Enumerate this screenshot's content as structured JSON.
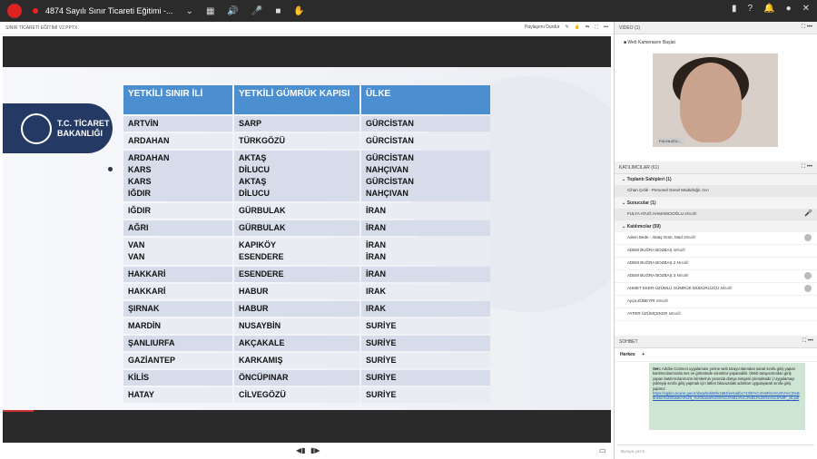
{
  "topbar": {
    "title": "4874 Sayılı Sınır Ticareti Eğitimi -..."
  },
  "share_pod": {
    "title": "SINIR TİCARETİ EĞİTİMİ V2.PPTX",
    "stop_sharing": "Paylaşımı Durdur"
  },
  "slide": {
    "ministry": [
      "T.C. TİCARET",
      "BAKANLIĞI"
    ],
    "headers": [
      "YETKİLİ SINIR İLİ",
      "YETKİLİ GÜMRÜK KAPISI",
      "ÜLKE"
    ],
    "rows": [
      {
        "a": "ARTVİN",
        "b": "SARP",
        "c": "GÜRCİSTAN"
      },
      {
        "a": "ARDAHAN",
        "b": "TÜRKGÖZÜ",
        "c": "GÜRCİSTAN"
      },
      {
        "a": "ARDAHAN\nKARS\nKARS\nIĞDIR",
        "b": "AKTAŞ\nDİLUCU\nAKTAŞ\nDİLUCU",
        "c": "GÜRCİSTAN\nNAHÇIVAN\nGÜRCİSTAN\nNAHÇIVAN"
      },
      {
        "a": "IĞDIR",
        "b": "GÜRBULAK",
        "c": "İRAN"
      },
      {
        "a": "AĞRI",
        "b": "GÜRBULAK",
        "c": "İRAN"
      },
      {
        "a": "VAN\nVAN",
        "b": "KAPIKÖY\nESENDERE",
        "c": "İRAN\nİRAN"
      },
      {
        "a": "HAKKARİ",
        "b": "ESENDERE",
        "c": "İRAN"
      },
      {
        "a": "HAKKARİ",
        "b": "HABUR",
        "c": "IRAK"
      },
      {
        "a": "ŞIRNAK",
        "b": "HABUR",
        "c": "IRAK"
      },
      {
        "a": "MARDİN",
        "b": "NUSAYBİN",
        "c": "SURİYE"
      },
      {
        "a": "ŞANLIURFA",
        "b": "AKÇAKALE",
        "c": "SURİYE"
      },
      {
        "a": "GAZİANTEP",
        "b": "KARKAMIŞ",
        "c": "SURİYE"
      },
      {
        "a": "KİLİS",
        "b": "ÖNCÜPINAR",
        "c": "SURİYE"
      },
      {
        "a": "HATAY",
        "b": "CİLVEGÖZÜ",
        "c": "SURİYE"
      }
    ]
  },
  "video": {
    "title": "VİDEO (1)",
    "webcam_label": "Web Kamerasını Başlat",
    "name_tag": "FULYA ATU..."
  },
  "participants": {
    "title": "KATILIMCILAR (61)",
    "hosts_title": "Toplantı Sahipleri (1)",
    "host": {
      "name": "Cihan Çelik - Personel Genel Müdürlüğü",
      "tag": "Sen"
    },
    "presenters_title": "Sunucular (1)",
    "presenter": {
      "name": "FULYA ATUĞ HAMAMCIOĞLU",
      "tag": "Misafir"
    },
    "attendees_title": "Katılımcılar (59)",
    "attendees": [
      {
        "name": "Adem Bede - Aktaş Güm. Müd",
        "tag": "Misafir"
      },
      {
        "name": "ADEM BUĞRA BOZBAŞ",
        "tag": "Misafir"
      },
      {
        "name": "ADEM BUĞRA BOZBAŞ 2",
        "tag": "Misafir"
      },
      {
        "name": "ADEM BUĞRA BOZBAŞ 3",
        "tag": "Misafir"
      },
      {
        "name": "AHMET EKER-ÜZÜMLÜ GÜMRÜK MÜDÜRLÜĞÜ",
        "tag": "Misafir"
      },
      {
        "name": "Ayça ZÜBEYİR",
        "tag": "Misafir"
      },
      {
        "name": "AYFER ÜZÜMÇEKER",
        "tag": "Misafir"
      }
    ]
  },
  "chat": {
    "title": "SOHBET",
    "tab": "Herkes",
    "sender": "Sen:",
    "message": "Adobe Connect uygulaması yerine web tarayıcılarından sanal sınıfa giriş yapan katılımcılarımızda ses ve görüntüde sıkıntılar yaşanabilir. (Web tarayıcısından giriş yapan katılımcılarımızın isimlerinin yanında dünya simgesi çıkmaktadır.) Uygulamayı yükleyip sınıfa giriş yapmak için lütfen bilavuzdaki adımları uygulayarak sınıfa giriş yapınız:",
    "link": "https://egitim.ticaret.gov.tr/data/5eb88fe1884fee54dbc743/E%C4%9Fitim%20V%C3%B6netim%20Sistemi%20_%20Sanal%20S%C4%B1n%C4%B1f%20Giri%C5%9F_v6.pdf",
    "input_placeholder": "Buraya yazın"
  }
}
